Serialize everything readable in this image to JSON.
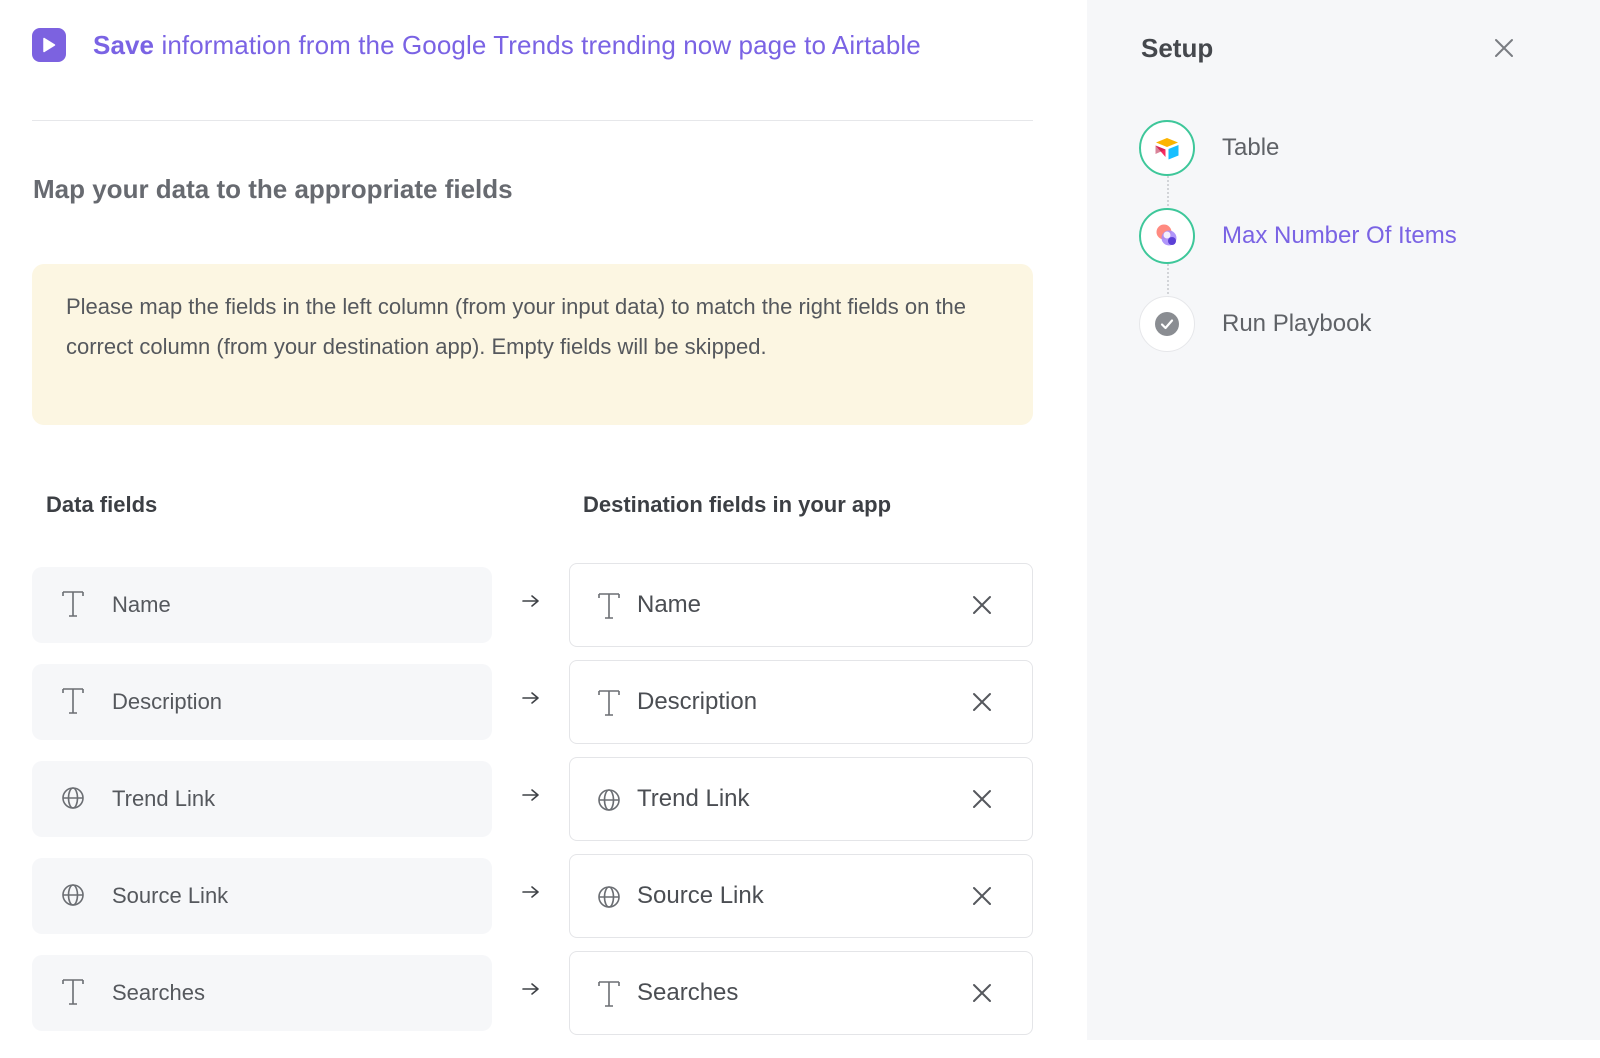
{
  "header": {
    "title_bold": "Save",
    "title_rest": " information from the Google Trends trending now page to Airtable"
  },
  "section": {
    "title": "Map your data to the appropriate fields"
  },
  "notice": {
    "text": "Please map the fields in the left column (from your input data) to match the right fields on the correct column (from your destination app). Empty fields will be skipped."
  },
  "columns": {
    "data_fields": "Data fields",
    "destination_fields": "Destination fields in your app"
  },
  "mappings": [
    {
      "source": "Name",
      "destination": "Name",
      "icon": "text-type-icon"
    },
    {
      "source": "Description",
      "destination": "Description",
      "icon": "text-type-icon"
    },
    {
      "source": "Trend Link",
      "destination": "Trend Link",
      "icon": "globe-icon"
    },
    {
      "source": "Source Link",
      "destination": "Source Link",
      "icon": "globe-icon"
    },
    {
      "source": "Searches",
      "destination": "Searches",
      "icon": "text-type-icon"
    }
  ],
  "setup": {
    "title": "Setup",
    "steps": [
      {
        "label": "Table",
        "status": "done",
        "icon": "airtable-icon"
      },
      {
        "label": "Max Number Of Items",
        "status": "active",
        "icon": "app-logo-icon"
      },
      {
        "label": "Run Playbook",
        "status": "pending",
        "icon": "check-circle-icon"
      }
    ]
  },
  "colors": {
    "accent": "#7a63e4",
    "done_ring": "#3ec79a",
    "notice_bg": "#fcf6e2",
    "sidebar_bg": "#f6f7f9"
  }
}
